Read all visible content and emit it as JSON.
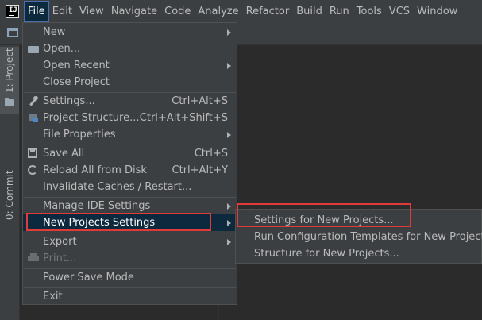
{
  "menubar": {
    "items": [
      {
        "label": "File",
        "mnemonic": "F",
        "rest": "ile",
        "active": true
      },
      {
        "label": "Edit",
        "mnemonic": "E",
        "rest": "dit"
      },
      {
        "label": "View",
        "mnemonic": "V",
        "rest": "iew"
      },
      {
        "label": "Navigate",
        "mnemonic": "N",
        "rest": "avigate"
      },
      {
        "label": "Code",
        "mnemonic": "C",
        "rest": "ode"
      },
      {
        "label": "Analyze",
        "mnemonic": "",
        "rest": "Analyze"
      },
      {
        "label": "Refactor",
        "mnemonic": "R",
        "rest": "efactor"
      },
      {
        "label": "Build",
        "mnemonic": "B",
        "rest": "uild"
      },
      {
        "label": "Run",
        "mnemonic": "R",
        "rest": "un"
      },
      {
        "label": "Tools",
        "mnemonic": "T",
        "rest": "ools"
      },
      {
        "label": "VCS",
        "mnemonic": "",
        "rest": "VCS"
      },
      {
        "label": "Window",
        "mnemonic": "W",
        "rest": "indow"
      }
    ]
  },
  "left_strip": {
    "project_tab": "1: Project",
    "commit_tab": "0: Commit"
  },
  "file_menu": {
    "items": [
      {
        "label": "New",
        "shortcut": "",
        "submenu": true
      },
      {
        "label": "Open...",
        "shortcut": ""
      },
      {
        "label": "Open Recent",
        "shortcut": "",
        "submenu": true
      },
      {
        "label": "Close Project",
        "shortcut": ""
      },
      {
        "label": "Settings...",
        "shortcut": "Ctrl+Alt+S"
      },
      {
        "label": "Project Structure...",
        "shortcut": "Ctrl+Alt+Shift+S"
      },
      {
        "label": "File Properties",
        "shortcut": "",
        "submenu": true
      },
      {
        "label": "Save All",
        "shortcut": "Ctrl+S"
      },
      {
        "label": "Reload All from Disk",
        "shortcut": "Ctrl+Alt+Y"
      },
      {
        "label": "Invalidate Caches / Restart...",
        "shortcut": ""
      },
      {
        "label": "Manage IDE Settings",
        "shortcut": "",
        "submenu": true
      },
      {
        "label": "New Projects Settings",
        "shortcut": "",
        "submenu": true,
        "selected": true
      },
      {
        "label": "Export",
        "shortcut": "",
        "submenu": true
      },
      {
        "label": "Print...",
        "shortcut": "",
        "disabled": true
      },
      {
        "label": "Power Save Mode",
        "shortcut": ""
      },
      {
        "label": "Exit",
        "shortcut": ""
      }
    ]
  },
  "submenu": {
    "items": [
      {
        "label": "Settings for New Projects..."
      },
      {
        "label": "Run Configuration Templates for New Projects..."
      },
      {
        "label": "Structure for New Projects..."
      }
    ]
  },
  "colors": {
    "background": "#2b2b2b",
    "panel": "#3c3f41",
    "selection": "#0d293e",
    "highlight_box": "#e03a3a",
    "text": "#bbbbbb"
  }
}
